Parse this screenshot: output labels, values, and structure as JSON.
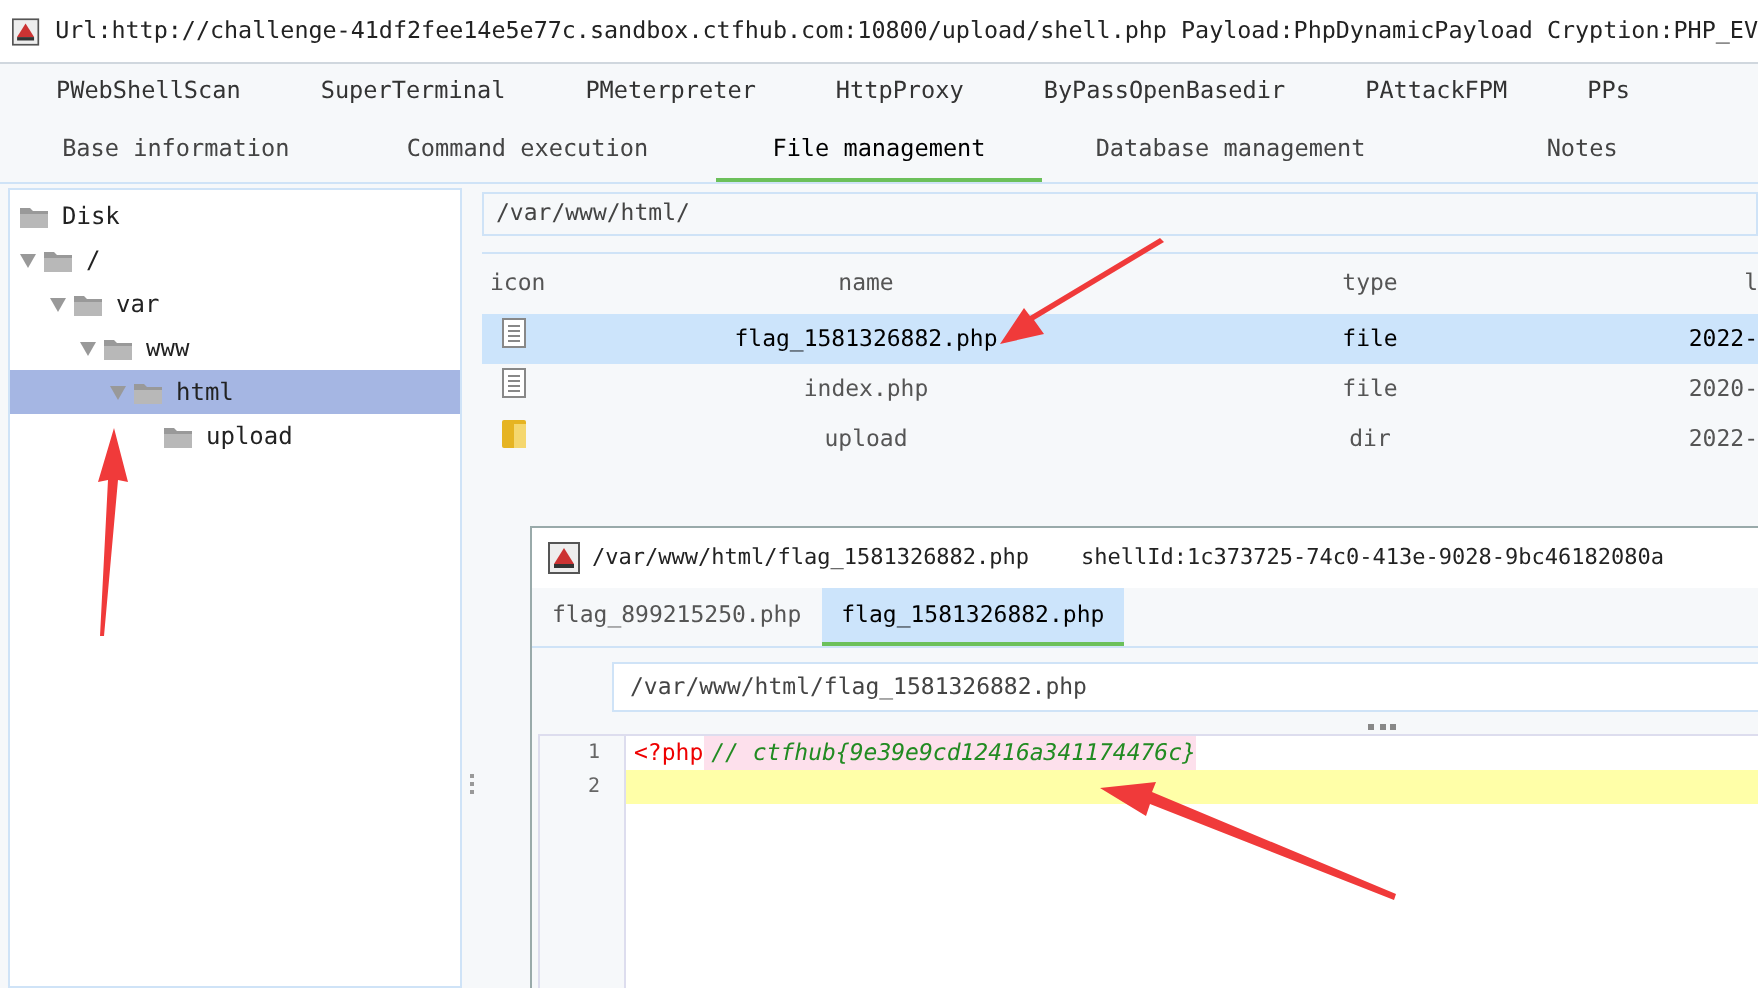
{
  "window": {
    "title": "Url:http://challenge-41df2fee14e5e77c.sandbox.ctfhub.com:10800/upload/shell.php Payload:PhpDynamicPayload Cryption:PHP_EV"
  },
  "plugin_tabs": [
    "PWebShellScan",
    "SuperTerminal",
    "PMeterpreter",
    "HttpProxy",
    "ByPassOpenBasedir",
    "PAttackFPM",
    "PPs"
  ],
  "main_tabs": [
    {
      "label": "Base information",
      "selected": false
    },
    {
      "label": "Command execution",
      "selected": false
    },
    {
      "label": "File management",
      "selected": true
    },
    {
      "label": "Database management",
      "selected": false
    },
    {
      "label": "Notes",
      "selected": false
    }
  ],
  "tree": [
    {
      "label": "Disk",
      "selected": false
    },
    {
      "label": "/",
      "expanded": true,
      "selected": false,
      "children": [
        {
          "label": "var",
          "expanded": true,
          "selected": false,
          "children": [
            {
              "label": "www",
              "expanded": true,
              "selected": false,
              "children": [
                {
                  "label": "html",
                  "expanded": true,
                  "selected": true,
                  "children": [
                    {
                      "label": "upload",
                      "selected": false
                    }
                  ]
                }
              ]
            }
          ]
        }
      ]
    }
  ],
  "path_field": {
    "value": "/var/www/html/"
  },
  "table": {
    "columns": [
      "icon",
      "name",
      "type",
      "l"
    ],
    "rows": [
      {
        "kind": "file",
        "name": "flag_1581326882.php",
        "type": "file",
        "column_4": "2022-",
        "selected": true
      },
      {
        "kind": "file",
        "name": "index.php",
        "type": "file",
        "column_4": "2020-",
        "selected": false
      },
      {
        "kind": "dir",
        "name": "upload",
        "type": "dir",
        "column_4": "2022-",
        "selected": false
      }
    ]
  },
  "editor": {
    "title": "/var/www/html/flag_1581326882.php",
    "shell_id": "shellId:1c373725-74c0-413e-9028-9bc46182080a",
    "tabs": [
      {
        "label": "flag_899215250.php",
        "selected": false
      },
      {
        "label": "flag_1581326882.php",
        "selected": true
      }
    ],
    "path": "/var/www/html/flag_1581326882.php",
    "lines": [
      {
        "number": "1",
        "current": false,
        "tokens": [
          {
            "kind": "keyword",
            "text": "<?php"
          },
          {
            "kind": "comment",
            "text": "// ctfhub{9e39e9cd12416a341174476c}"
          }
        ]
      },
      {
        "number": "2",
        "current": true
      }
    ]
  }
}
